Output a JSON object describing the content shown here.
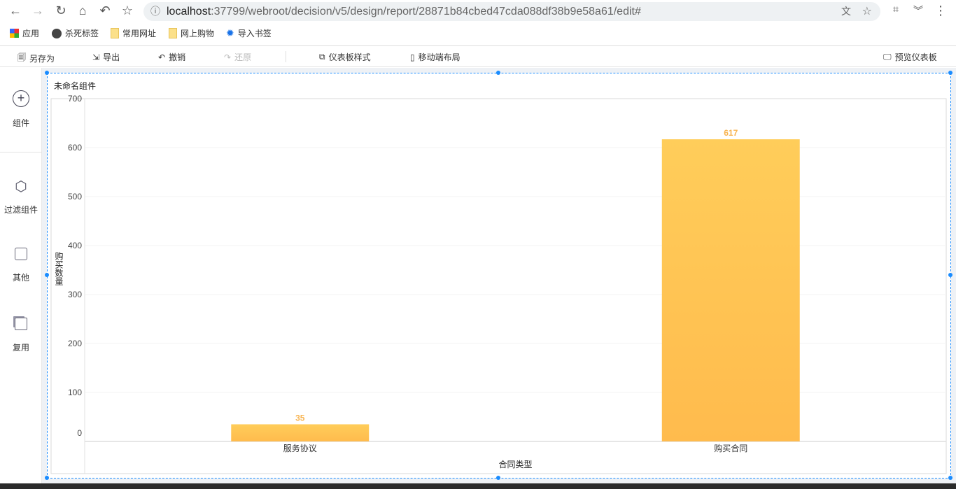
{
  "browser": {
    "url_host": "localhost",
    "url_rest": ":37799/webroot/decision/v5/design/report/28871b84cbed47cda088df38b9e58a61/edit#"
  },
  "bookmarks": [
    {
      "label": "应用",
      "icon": "apps-grid-icon"
    },
    {
      "label": "杀死标签",
      "icon": "globe-icon"
    },
    {
      "label": "常用网址",
      "icon": "folder-icon"
    },
    {
      "label": "网上购物",
      "icon": "folder-icon"
    },
    {
      "label": "导入书签",
      "icon": "gear-icon"
    }
  ],
  "toolbar": {
    "save_as": "另存为",
    "export": "导出",
    "undo": "撤销",
    "redo": "还原",
    "dashboard_style": "仪表板样式",
    "mobile_layout": "移动端布局",
    "preview": "预览仪表板"
  },
  "sidebar": [
    {
      "label": "组件",
      "icon": "plus-circle-icon"
    },
    {
      "label": "过滤组件",
      "icon": "cube-icon"
    },
    {
      "label": "其他",
      "icon": "note-icon"
    },
    {
      "label": "复用",
      "icon": "windows-icon"
    }
  ],
  "widget": {
    "title": "未命名组件"
  },
  "colors": {
    "bar_top": "#ffcd5a",
    "bar_bottom": "#ffbb4d",
    "label": "#f8b451",
    "selection": "#1a8cff"
  },
  "chart_data": {
    "type": "bar",
    "title": "未命名组件",
    "categories": [
      "服务协议",
      "购买合同"
    ],
    "values": [
      35,
      617
    ],
    "xlabel": "合同类型",
    "ylabel": "购买数量",
    "ylim": [
      0,
      700
    ],
    "yticks": [
      0,
      100,
      200,
      300,
      400,
      500,
      600,
      700
    ],
    "grid": true
  }
}
